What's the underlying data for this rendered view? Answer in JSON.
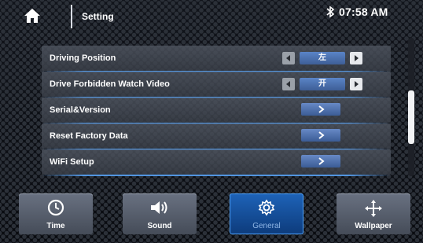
{
  "header": {
    "title": "Setting",
    "time": "07:58 AM",
    "bluetooth_symbol": "∗",
    "home_icon": "home-icon"
  },
  "settings": [
    {
      "label": "Driving Position",
      "control": "selector",
      "value": "左"
    },
    {
      "label": "Drive Forbidden Watch Video",
      "control": "selector",
      "value": "开"
    },
    {
      "label": "Serial&Version",
      "control": "chevron"
    },
    {
      "label": "Reset Factory Data",
      "control": "chevron"
    },
    {
      "label": "WiFi Setup",
      "control": "chevron"
    }
  ],
  "scrollbar": {
    "position_fraction": 0.62
  },
  "tabs": [
    {
      "label": "Time",
      "icon": "clock-icon",
      "active": false
    },
    {
      "label": "Sound",
      "icon": "speaker-icon",
      "active": false
    },
    {
      "label": "General",
      "icon": "gear-icon",
      "active": true
    },
    {
      "label": "Wallpaper",
      "icon": "move-arrows-icon",
      "active": false
    }
  ],
  "colors": {
    "accent": "#4da3ff",
    "active_tab": "#1e63b8",
    "row_bg": "#4b515c",
    "value_button": "#4f74b3"
  }
}
